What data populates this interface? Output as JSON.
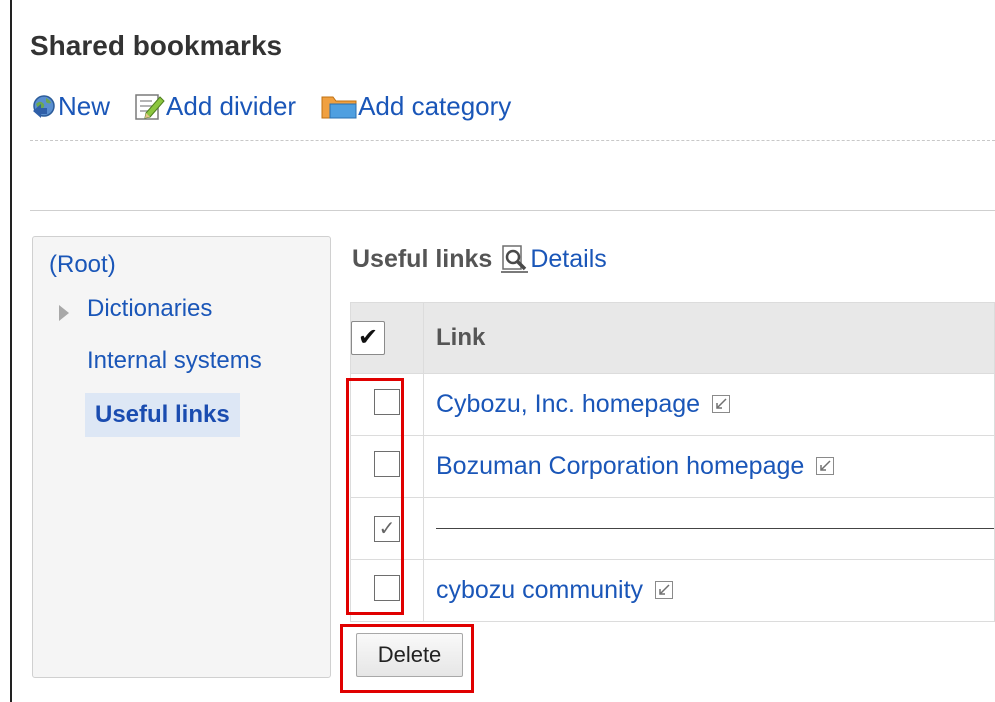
{
  "page": {
    "title": "Shared bookmarks"
  },
  "toolbar": {
    "new_label": "New",
    "add_divider_label": "Add divider",
    "add_category_label": "Add category"
  },
  "sidebar": {
    "root_label": "(Root)",
    "items": [
      {
        "label": "Dictionaries",
        "expandable": true,
        "selected": false
      },
      {
        "label": "Internal systems",
        "expandable": false,
        "selected": false
      },
      {
        "label": "Useful links",
        "expandable": false,
        "selected": true
      }
    ]
  },
  "main": {
    "folder_name": "Useful links",
    "details_label": "Details",
    "table": {
      "header_check": "✔",
      "column_link": "Link",
      "rows": [
        {
          "type": "link",
          "checked": false,
          "label": "Cybozu, Inc. homepage"
        },
        {
          "type": "link",
          "checked": false,
          "label": "Bozuman Corporation homepage"
        },
        {
          "type": "divider",
          "checked": true,
          "label": ""
        },
        {
          "type": "link",
          "checked": false,
          "label": "cybozu community"
        }
      ]
    },
    "delete_label": "Delete"
  },
  "icons": {
    "new": "globe-arrow-icon",
    "add_divider": "edit-document-icon",
    "add_category": "folder-icon",
    "details": "magnifier-document-icon",
    "external": "open-in-new-window-icon",
    "tree_expander": "triangle-right-icon"
  },
  "colors": {
    "link": "#1a56b8",
    "selected_background": "#dde7f5",
    "highlight": "#e00000",
    "table_header": "#e8e8e8",
    "sidebar_background": "#f5f5f5"
  }
}
